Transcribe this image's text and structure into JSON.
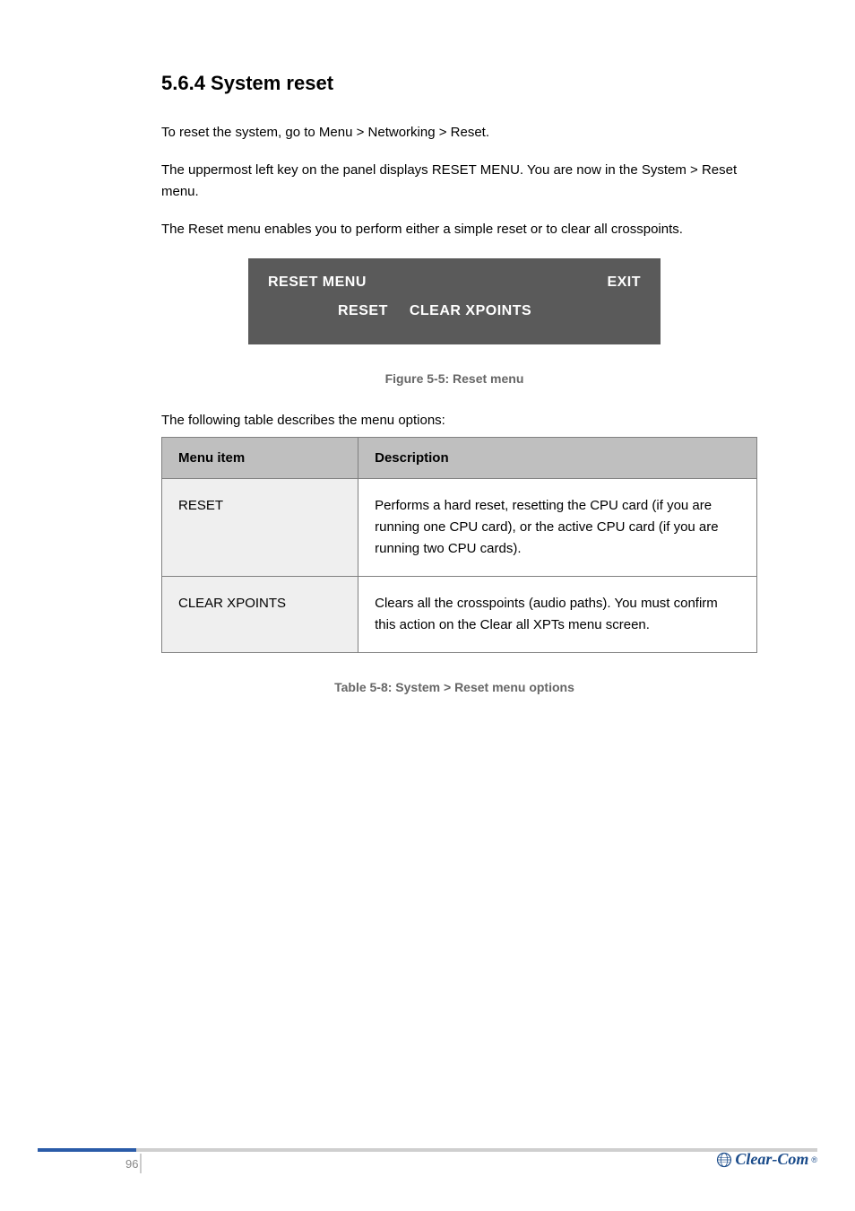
{
  "section": {
    "number": "5.6.4",
    "title": "System reset",
    "heading": "5.6.4 System reset"
  },
  "paragraphs": {
    "p1": "To reset the system, go to Menu > Networking > Reset.",
    "p2": "The uppermost left key on the panel displays RESET MENU. You are now in the System > Reset menu.",
    "p3": "The Reset menu enables you to perform either a simple reset or to clear all crosspoints."
  },
  "menu": {
    "title": "RESET MENU",
    "exit": "EXIT",
    "opt1": "RESET",
    "opt2": "CLEAR XPOINTS"
  },
  "figure_caption": "Figure 5-5: Reset menu",
  "table_intro": "The following table describes the menu options:",
  "table": {
    "h1": "Menu item",
    "h2": "Description",
    "r1c1": "RESET",
    "r1c2": "Performs a hard reset, resetting the CPU card (if you are running one CPU card), or the active CPU card (if you are running two CPU cards).",
    "r2c1": "CLEAR XPOINTS",
    "r2c2": "Clears all the crosspoints (audio paths).\nYou must confirm this action on the Clear all XPTs menu screen."
  },
  "table_caption": "Table 5-8: System > Reset menu options",
  "footer": {
    "page": "96",
    "brand": "Clear-Com"
  }
}
